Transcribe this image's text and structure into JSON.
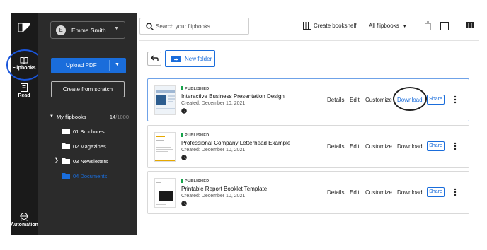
{
  "rail": {
    "items": [
      {
        "label": "Flipbooks",
        "icon": "book-icon",
        "active": true
      },
      {
        "label": "Read",
        "icon": "read-icon"
      },
      {
        "label": "Automation",
        "icon": "automation-icon"
      }
    ]
  },
  "sidebar": {
    "user": {
      "name": "Emma Smith",
      "avatar_initial": "E"
    },
    "upload_label": "Upload PDF",
    "scratch_label": "Create from scratch",
    "tree": {
      "label": "My flipbooks",
      "count": "14",
      "total": "/1000",
      "folders": [
        {
          "label": "01 Brochures",
          "expandable": false,
          "active": false
        },
        {
          "label": "02 Magazines",
          "expandable": false,
          "active": false
        },
        {
          "label": "03 Newsletters",
          "expandable": true,
          "active": false
        },
        {
          "label": "04 Documents",
          "expandable": false,
          "active": true
        }
      ]
    }
  },
  "toolbar": {
    "search_placeholder": "Search your flipbooks",
    "shelf_label": "Create bookshelf",
    "filter_label": "All flipbooks"
  },
  "actions": {
    "new_folder_label": "New folder"
  },
  "flipbooks": [
    {
      "status": "PUBLISHED",
      "title": "Interactive Business Presentation Design",
      "created": "Created: December 10, 2021",
      "thumb": "presentation",
      "selected": true,
      "download_highlighted": true,
      "actions": {
        "details": "Details",
        "edit": "Edit",
        "customize": "Customize",
        "download": "Download",
        "share": "Share"
      }
    },
    {
      "status": "PUBLISHED",
      "title": "Professional Company Letterhead Example",
      "created": "Created: December 10, 2021",
      "thumb": "letterhead",
      "selected": false,
      "download_highlighted": false,
      "actions": {
        "details": "Details",
        "edit": "Edit",
        "customize": "Customize",
        "download": "Download",
        "share": "Share"
      }
    },
    {
      "status": "PUBLISHED",
      "title": "Printable Report Booklet Template",
      "created": "Created: December 10, 2021",
      "thumb": "report",
      "selected": false,
      "download_highlighted": false,
      "actions": {
        "details": "Details",
        "edit": "Edit",
        "customize": "Customize",
        "download": "Download",
        "share": "Share"
      }
    }
  ],
  "colors": {
    "accent": "#1a6ddb",
    "rail_bg": "#1a1a1a",
    "sidebar_bg": "#2b2b2b",
    "published": "#16a34a",
    "annotation_blue": "#1a56db"
  }
}
